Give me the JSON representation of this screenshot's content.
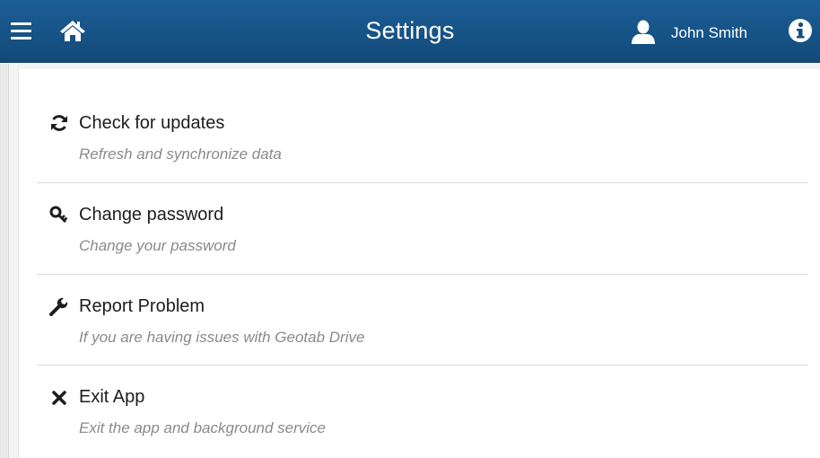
{
  "header": {
    "menu_icon": "hamburger-icon",
    "home_icon": "home-icon",
    "title": "Settings",
    "user_icon": "user-icon",
    "user_name": "John Smith",
    "info_icon": "info-icon",
    "background_color": "#1a5a8e"
  },
  "settings": {
    "items": [
      {
        "icon": "refresh-icon",
        "label": "Check for updates",
        "description": "Refresh and synchronize data"
      },
      {
        "icon": "key-icon",
        "label": "Change password",
        "description": "Change your password"
      },
      {
        "icon": "wrench-icon",
        "label": "Report Problem",
        "description": "If you are having issues with Geotab Drive"
      },
      {
        "icon": "close-icon",
        "label": "Exit App",
        "description": "Exit the app and background service"
      }
    ]
  }
}
